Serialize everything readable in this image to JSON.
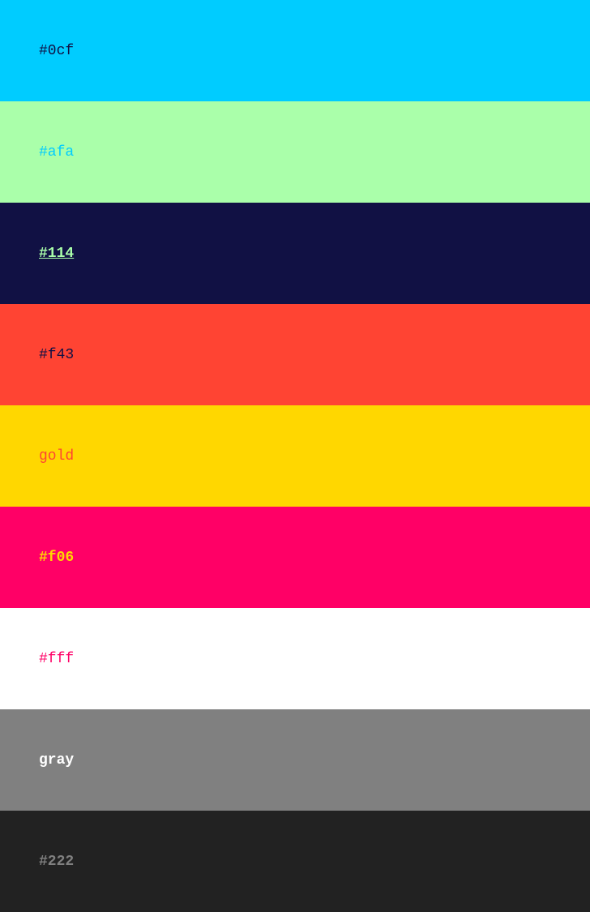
{
  "swatches": [
    {
      "label": "#0cf",
      "background": "#00ccff",
      "text_color": "#111144",
      "bold": false,
      "underline": false
    },
    {
      "label": "#afa",
      "background": "#aaffaa",
      "text_color": "#00ccff",
      "bold": false,
      "underline": false
    },
    {
      "label": "#114",
      "background": "#111144",
      "text_color": "#aaffaa",
      "bold": true,
      "underline": true
    },
    {
      "label": "#f43",
      "background": "#ff4433",
      "text_color": "#111144",
      "bold": false,
      "underline": false
    },
    {
      "label": "gold",
      "background": "#ffd700",
      "text_color": "#ff4433",
      "bold": false,
      "underline": false
    },
    {
      "label": "#f06",
      "background": "#ff0066",
      "text_color": "#ffd700",
      "bold": true,
      "underline": false
    },
    {
      "label": "#fff",
      "background": "#ffffff",
      "text_color": "#ff0066",
      "bold": false,
      "underline": false
    },
    {
      "label": "gray",
      "background": "#808080",
      "text_color": "#ffffff",
      "bold": true,
      "underline": false
    },
    {
      "label": "#222",
      "background": "#222222",
      "text_color": "#808080",
      "bold": true,
      "underline": false
    }
  ]
}
